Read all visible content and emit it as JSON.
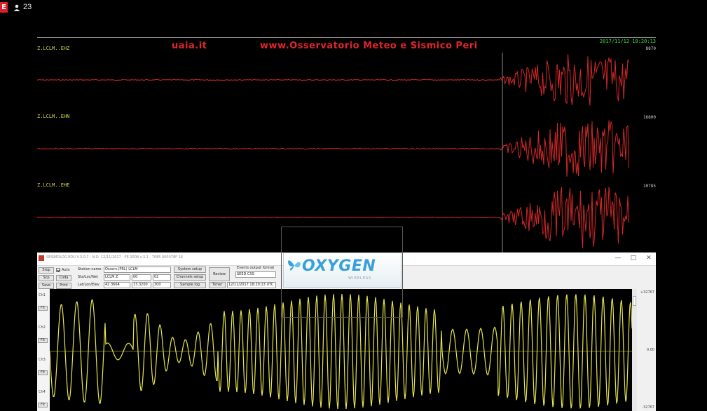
{
  "stream": {
    "live_badge": "E",
    "viewer_count": "23",
    "viewer_icon": "person-icon"
  },
  "seismo_display": {
    "banner_left": "uaia.it",
    "banner_right": "www.Osservatorio Meteo e Sismico Peri",
    "clock": "2017/11/12 18:20:13",
    "channels": [
      {
        "label": "Z.LCLM..EHZ",
        "scale": "8870"
      },
      {
        "label": "Z.LCLM..EHN",
        "scale": "16800"
      },
      {
        "label": "Z.LCLM..EHE",
        "scale": "10785"
      }
    ],
    "trace_color": "#d42828",
    "marker_color": "#8a8a8a"
  },
  "program_window": {
    "title": "SEISMOLOG EDU V.3.0.7 - N.D. 12/11/2017 - FE 2008 v.3.1 - 7085 000078F 16",
    "toolbar": {
      "stop": "Stop",
      "go": "Go",
      "scp": "Scp",
      "coda": "Coda",
      "save": "Save",
      "print": "Print",
      "auto_label": "Auto",
      "station_label": "Station name",
      "station_value": "Osserv.(PRL) LCLM",
      "sta_label": "Sta/Loc/Net",
      "sta_value": "LCLM Z",
      "loc_value": "00",
      "net_value": "02",
      "latlon_label": "Lat/Lon/Elev",
      "lat_value": "42.3664",
      "lon_value": "13.3200",
      "elev_value": "300",
      "system_setup": "System setup",
      "channels_setup": "Channels setup",
      "sample_log": "Sample log",
      "review": "Review",
      "timer": "Timer",
      "events_label": "Events output format",
      "events_value": "SEED CSS",
      "time_value": "12/11/2017 18:20:13 UTC"
    },
    "side_channels": [
      "Ch1",
      "Ch2",
      "Ch3",
      "Ch4"
    ],
    "side_button": "Flt",
    "right_scale": [
      "+32767",
      "0.00",
      "-32767"
    ],
    "trace_color": "#e6e64a"
  },
  "ad": {
    "brand": "OXYGEN",
    "tagline": "WIRELESS",
    "logo_icon": "butterfly-logo-icon",
    "color": "#3aa0d8"
  },
  "window_controls": {
    "min": "—",
    "max": "□",
    "close": "✕"
  }
}
